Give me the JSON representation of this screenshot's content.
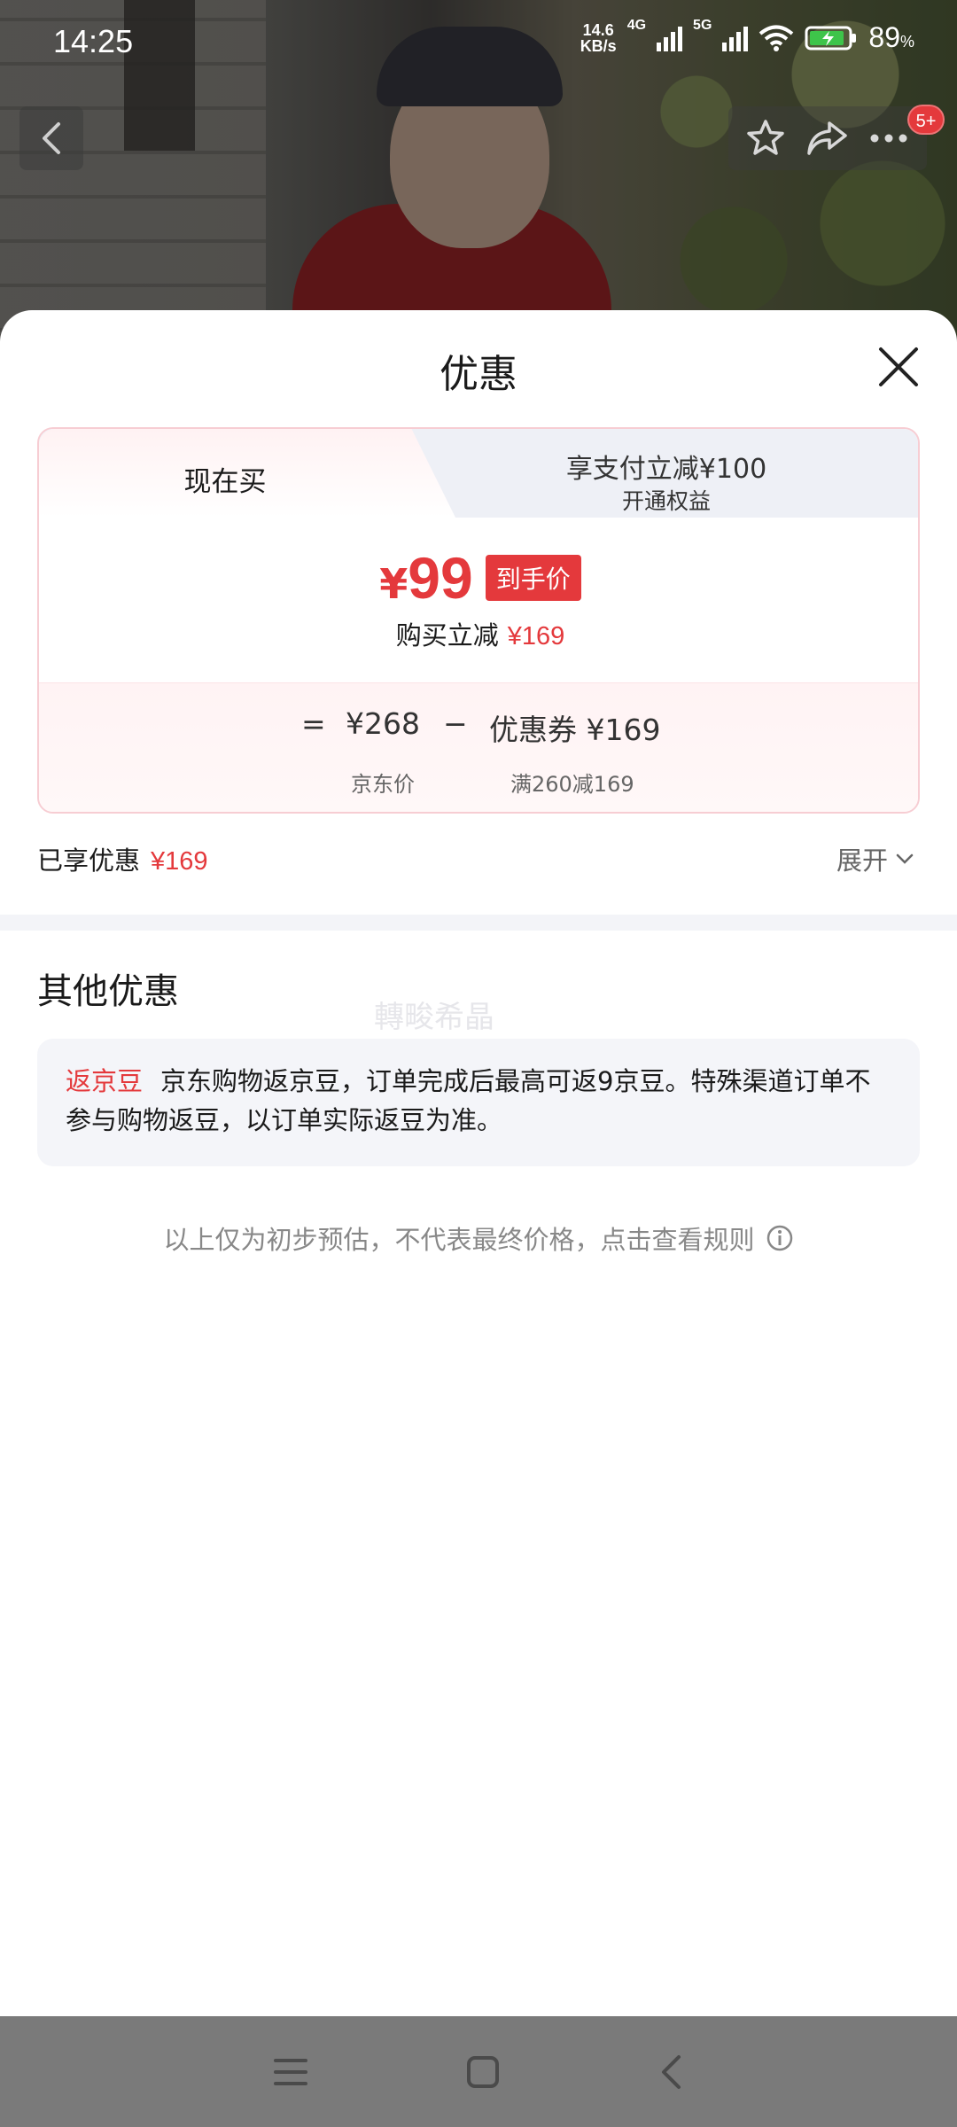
{
  "status_bar": {
    "time": "14:25",
    "net_speed_value": "14.6",
    "net_speed_unit": "KB/s",
    "sig1_label": "4G",
    "sig2_label": "5G",
    "battery_percent": "89",
    "battery_unit": "%"
  },
  "nav": {
    "badge": "5+"
  },
  "sheet": {
    "title": "优惠",
    "tabs": [
      {
        "label": "现在买"
      },
      {
        "label": "享支付立减¥100",
        "sub": "开通权益"
      }
    ],
    "price": {
      "currency": "¥",
      "amount": "99",
      "tag": "到手价"
    },
    "save": {
      "label": "购买立减",
      "amount": "¥169"
    },
    "calc": {
      "equals": "=",
      "jd_price": "¥268",
      "minus": "−",
      "coupon": "优惠券 ¥169",
      "jd_price_label": "京东价",
      "coupon_rule": "满260减169"
    },
    "enjoyed": {
      "label": "已享优惠",
      "amount": "¥169"
    },
    "expand_label": "展开",
    "other_title": "其他优惠",
    "watermark": "轉畯希晶",
    "bean": {
      "tag": "返京豆",
      "text": "京东购物返京豆，订单完成后最高可返9京豆。特殊渠道订单不参与购物返豆，以订单实际返豆为准。"
    },
    "disclaimer": "以上仅为初步预估，不代表最终价格，点击查看规则"
  },
  "colors": {
    "accent_red": "#e4393c",
    "card_border": "#f7cdd3",
    "muted_text": "#888888"
  },
  "icons": [
    "back-icon",
    "star-icon",
    "share-icon",
    "more-icon",
    "close-icon",
    "chevron-down-icon",
    "info-icon",
    "menu-icon",
    "home-icon",
    "nav-back-icon"
  ]
}
